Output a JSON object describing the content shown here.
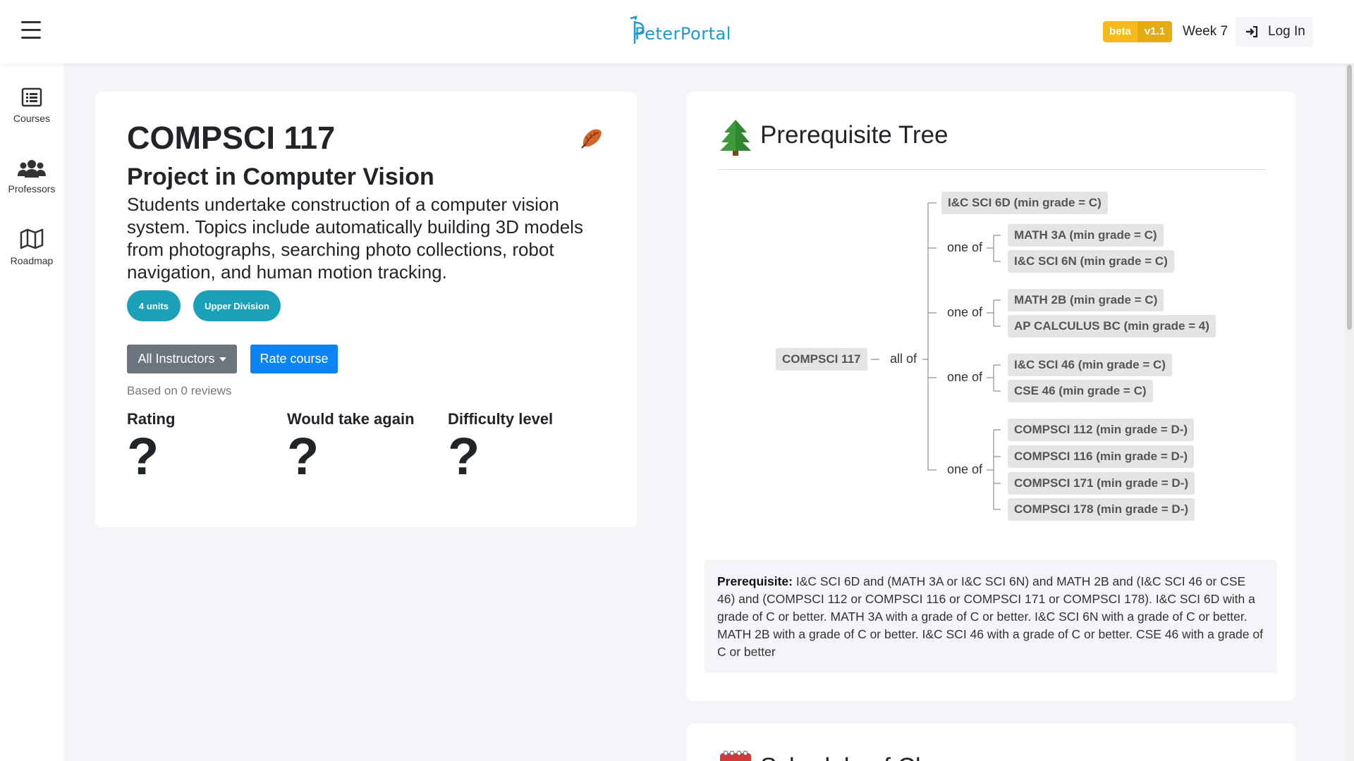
{
  "header": {
    "logo_text": "PeterPortal",
    "beta_label": "beta",
    "version": "v1.1",
    "week": "Week 7",
    "login_label": "Log In"
  },
  "sidebar": {
    "items": [
      {
        "label": "Courses",
        "icon": "list-icon"
      },
      {
        "label": "Professors",
        "icon": "users-icon"
      },
      {
        "label": "Roadmap",
        "icon": "map-icon"
      }
    ]
  },
  "course": {
    "code": "COMPSCI 117",
    "name": "Project in Computer Vision",
    "description": "Students undertake construction of a computer vision system. Topics include automatically building 3D models from photographs, searching photo collections, robot navigation, and human motion tracking.",
    "units": "4 units",
    "level": "Upper Division",
    "instructor_dropdown": "All Instructors",
    "rate_label": "Rate course",
    "reviews_text": "Based on 0 reviews",
    "stats": [
      {
        "label": "Rating",
        "value": "?"
      },
      {
        "label": "Would take again",
        "value": "?"
      },
      {
        "label": "Difficulty level",
        "value": "?"
      }
    ]
  },
  "prereq_tree": {
    "title": "Prerequisite Tree",
    "root": "COMPSCI 117",
    "root_connector": "all of",
    "nodes": {
      "ics6d": "I&C SCI 6D (min grade = C)",
      "math3a": "MATH 3A (min grade = C)",
      "ics6n": "I&C SCI 6N (min grade = C)",
      "math2b": "MATH 2B (min grade = C)",
      "apcalc": "AP CALCULUS BC (min grade = 4)",
      "ics46": "I&C SCI 46 (min grade = C)",
      "cse46": "CSE 46 (min grade = C)",
      "cs112": "COMPSCI 112 (min grade = D-)",
      "cs116": "COMPSCI 116 (min grade = D-)",
      "cs171": "COMPSCI 171 (min grade = D-)",
      "cs178": "COMPSCI 178 (min grade = D-)"
    },
    "one_of": "one of",
    "prereq_label": "Prerequisite:",
    "prereq_text": " I&C SCI 6D and (MATH 3A or I&C SCI 6N) and MATH 2B and (I&C SCI 46 or CSE 46) and (COMPSCI 112 or COMPSCI 116 or COMPSCI 171 or COMPSCI 178). I&C SCI 6D with a grade of C or better. MATH 3A with a grade of C or better. I&C SCI 6N with a grade of C or better. MATH 2B with a grade of C or better. I&C SCI 46 with a grade of C or better. CSE 46 with a grade of C or better"
  },
  "bottom_card": {
    "title": "Schedule of Classes"
  },
  "colors": {
    "accent_blue": "#0d84f5",
    "pill_teal": "#1aa0b8",
    "beta_yellow": "#f7bb19",
    "logo_blue": "#1f9ad0"
  }
}
